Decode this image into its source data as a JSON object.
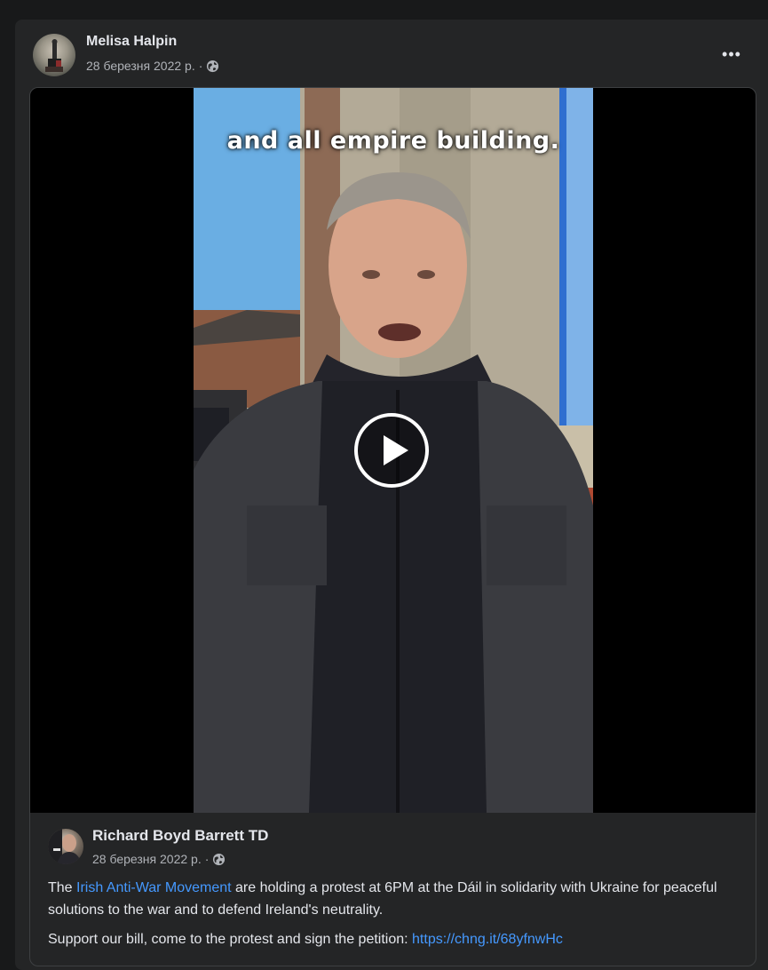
{
  "post": {
    "author": "Melisa Halpin",
    "date": "28 березня 2022 р.",
    "separator": "·",
    "privacy_icon": "globe-icon",
    "more_label": "•••"
  },
  "video": {
    "caption": "and all empire building.",
    "play_icon": "play-icon"
  },
  "shared": {
    "author": "Richard Boyd Barrett TD",
    "date": "28 березня 2022 р.",
    "separator": "·",
    "privacy_icon": "globe-icon",
    "para1_before": "The ",
    "para1_link": "Irish Anti-War Movement",
    "para1_after": " are holding a protest at 6PM at the Dáil in solidarity with Ukraine for peaceful solutions to the war and to defend Ireland's neutrality.",
    "para2_before": "Support our bill, come to the protest and sign the petition: ",
    "para2_link": "https://chng.it/68yfnwHc"
  },
  "colors": {
    "background": "#18191a",
    "card": "#242526",
    "link": "#4599ff",
    "secondary_text": "#b0b3b8"
  }
}
